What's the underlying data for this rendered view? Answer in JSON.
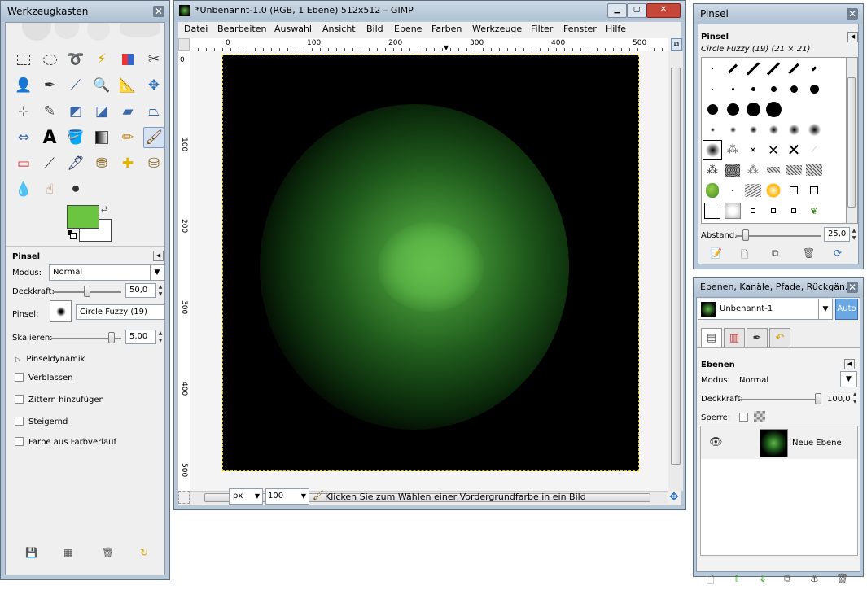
{
  "toolbox": {
    "title": "Werkzeugkasten",
    "tool_options_title": "Pinsel",
    "mode_label": "Modus:",
    "mode_value": "Normal",
    "opacity_label": "Deckkraft:",
    "opacity_value": "50,0",
    "opacity_fraction": 0.5,
    "brush_label": "Pinsel:",
    "brush_value": "Circle Fuzzy (19)",
    "scale_label": "Skalieren:",
    "scale_value": "5,00",
    "dynamics_label": "Pinseldynamik",
    "checkboxes": [
      "Verblassen",
      "Zittern hinzufügen",
      "Steigernd",
      "Farbe aus Farbverlauf"
    ],
    "fg_color": "#6cc541",
    "bg_color": "#ffffff"
  },
  "image_window": {
    "title": "*Unbenannt-1.0 (RGB, 1 Ebene) 512x512 – GIMP",
    "menu": [
      "Datei",
      "Bearbeiten",
      "Auswahl",
      "Ansicht",
      "Bild",
      "Ebene",
      "Farben",
      "Werkzeuge",
      "Filter",
      "Fenster",
      "Hilfe"
    ],
    "ruler_h": [
      "0",
      "100",
      "200",
      "300",
      "400",
      "500"
    ],
    "ruler_v": [
      "0",
      "100",
      "200",
      "300",
      "400",
      "500"
    ],
    "unit": "px",
    "zoom": "100",
    "status": "Klicken Sie zum Wählen einer Vordergrundfarbe in ein Bild"
  },
  "brushes": {
    "title": "Pinsel",
    "header": "Pinsel",
    "selected": "Circle Fuzzy (19) (21 × 21)",
    "spacing_label": "Abstand:",
    "spacing_value": "25,0"
  },
  "layers": {
    "title": "Ebenen, Kanäle, Pfade, Rückgän...",
    "image_name": "Unbenannt-1",
    "auto_label": "Auto",
    "header": "Ebenen",
    "mode_label": "Modus:",
    "mode_value": "Normal",
    "opacity_label": "Deckkraft:",
    "opacity_value": "100,0",
    "lock_label": "Sperre:",
    "layer_name": "Neue Ebene"
  }
}
